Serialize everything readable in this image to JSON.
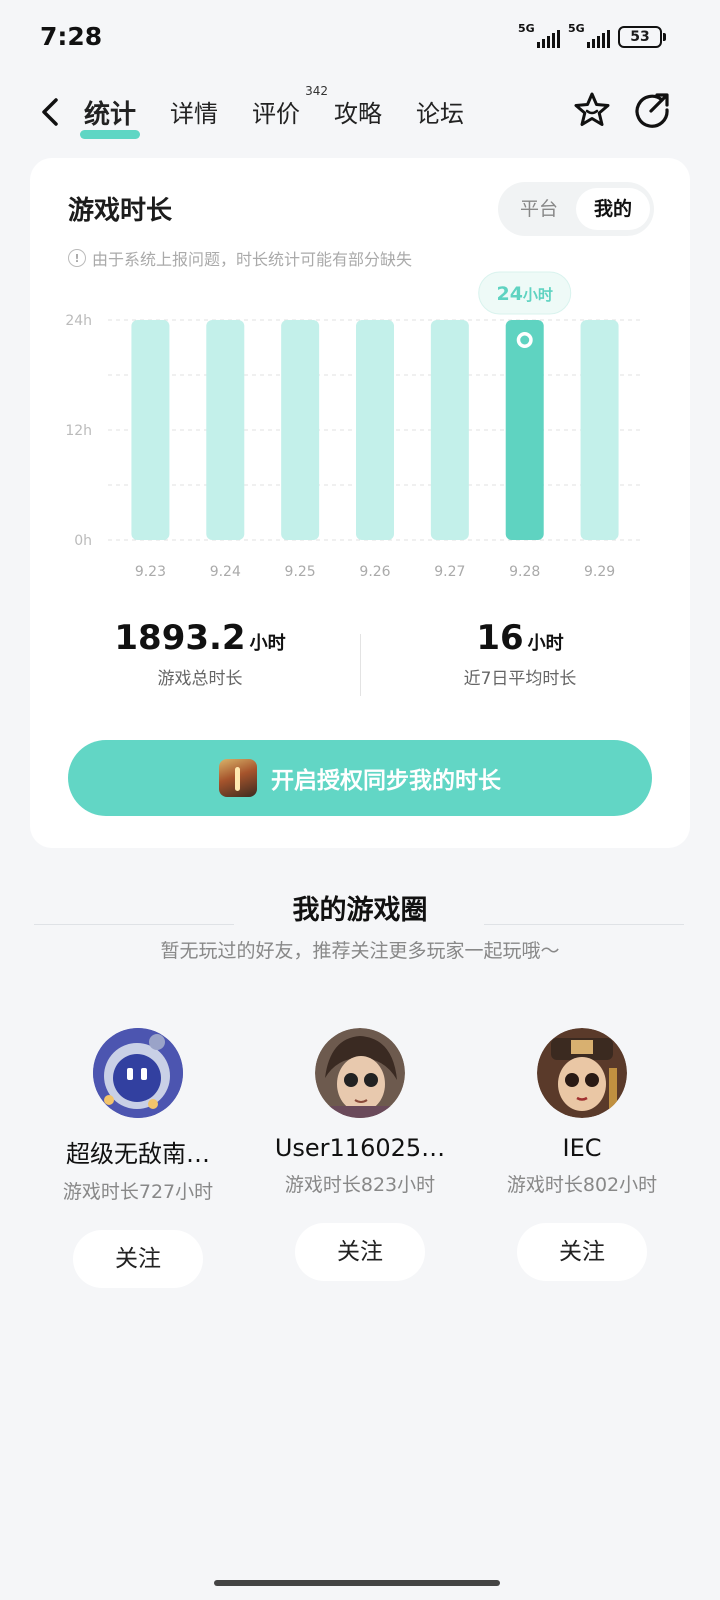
{
  "status_bar": {
    "time": "7:28",
    "net1": "5G",
    "net2": "5G",
    "battery": "53"
  },
  "nav": {
    "tabs": [
      {
        "label": "统计",
        "active": true
      },
      {
        "label": "详情"
      },
      {
        "label": "评价",
        "badge": "342"
      },
      {
        "label": "攻略"
      },
      {
        "label": "论坛"
      }
    ]
  },
  "card": {
    "title": "游戏时长",
    "segment": {
      "platform": "平台",
      "mine": "我的",
      "selected": "我的"
    },
    "notice": "由于系统上报问题，时长统计可能有部分缺失",
    "tooltip_value": "24",
    "tooltip_unit": "小时",
    "total": {
      "value": "1893.2",
      "unit": "小时",
      "label": "游戏总时长"
    },
    "avg": {
      "value": "16",
      "unit": "小时",
      "label": "近7日平均时长"
    },
    "sync_button": "开启授权同步我的时长"
  },
  "chart_data": {
    "type": "bar",
    "categories": [
      "9.23",
      "9.24",
      "9.25",
      "9.26",
      "9.27",
      "9.28",
      "9.29"
    ],
    "values": [
      24,
      24,
      24,
      24,
      24,
      24,
      24
    ],
    "highlight_index": 5,
    "yticks": [
      "0h",
      "12h",
      "24h"
    ],
    "ylim": [
      0,
      24
    ],
    "grid": true,
    "colors": {
      "bar": "#c3f0ea",
      "highlight": "#5fd3c1",
      "grid": "#e2e2e2"
    }
  },
  "game_circle": {
    "title": "我的游戏圈",
    "subtitle": "暂无玩过的好友，推荐关注更多玩家一起玩哦～",
    "follow_label": "关注",
    "users": [
      {
        "name": "超级无敌南…",
        "play": "游戏时长727小时"
      },
      {
        "name": "User116025…",
        "play": "游戏时长823小时"
      },
      {
        "name": "IEC",
        "play": "游戏时长802小时"
      }
    ]
  }
}
